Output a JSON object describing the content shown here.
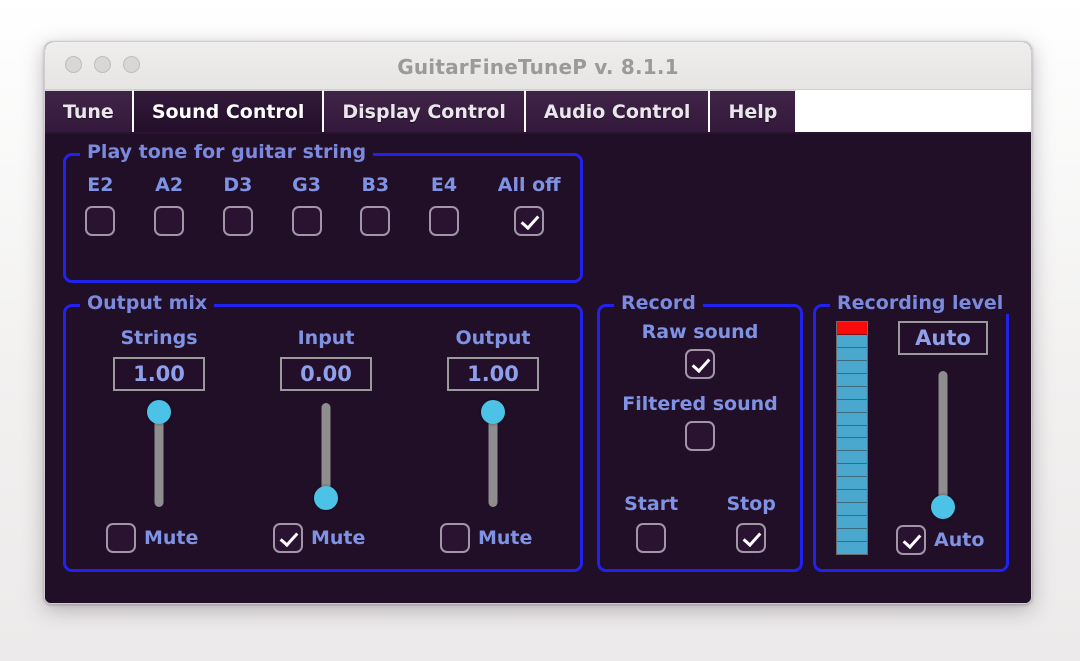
{
  "window": {
    "title": "GuitarFineTuneP v. 8.1.1",
    "traffic_lights": [
      "close-button",
      "minimize-button",
      "zoom-button"
    ]
  },
  "tabs": [
    {
      "label": "Tune",
      "active": false
    },
    {
      "label": "Sound Control",
      "active": true
    },
    {
      "label": "Display Control",
      "active": false
    },
    {
      "label": "Audio Control",
      "active": false
    },
    {
      "label": "Help",
      "active": false
    }
  ],
  "play_tone_group": {
    "title": "Play tone for guitar string",
    "strings": [
      {
        "label": "E2",
        "checked": false
      },
      {
        "label": "A2",
        "checked": false
      },
      {
        "label": "D3",
        "checked": false
      },
      {
        "label": "G3",
        "checked": false
      },
      {
        "label": "B3",
        "checked": false
      },
      {
        "label": "E4",
        "checked": false
      },
      {
        "label": "All off",
        "checked": true
      }
    ]
  },
  "output_mix_group": {
    "title": "Output mix",
    "channels": [
      {
        "label": "Strings",
        "value": "1.00",
        "slider_percent": 100,
        "mute_label": "Mute",
        "muted": false
      },
      {
        "label": "Input",
        "value": "0.00",
        "slider_percent": 0,
        "mute_label": "Mute",
        "muted": true
      },
      {
        "label": "Output",
        "value": "1.00",
        "slider_percent": 100,
        "mute_label": "Mute",
        "muted": false
      }
    ]
  },
  "record_group": {
    "title": "Record",
    "raw_sound_label": "Raw sound",
    "raw_sound_checked": true,
    "filtered_sound_label": "Filtered sound",
    "filtered_sound_checked": false,
    "start_label": "Start",
    "start_checked": false,
    "stop_label": "Stop",
    "stop_checked": true
  },
  "recording_level_group": {
    "title": "Recording level",
    "meter": {
      "segments": 18,
      "peak_color": "#f90b0b",
      "bar_color": "#4aa8cf",
      "level_percent": 100
    },
    "mode_value": "Auto",
    "slider_percent": 7,
    "auto_label": "Auto",
    "auto_checked": true
  },
  "colors": {
    "background": "#200f27",
    "group_border": "#2222ee",
    "label_text": "#8092e4",
    "slider_knob": "#4cc2e6",
    "slider_track": "#8e8e8e",
    "tab_active": "#230f2a",
    "tab_inactive": "#3f2447",
    "meter_peak": "#f90b0b",
    "meter_bar": "#4aa8cf"
  }
}
